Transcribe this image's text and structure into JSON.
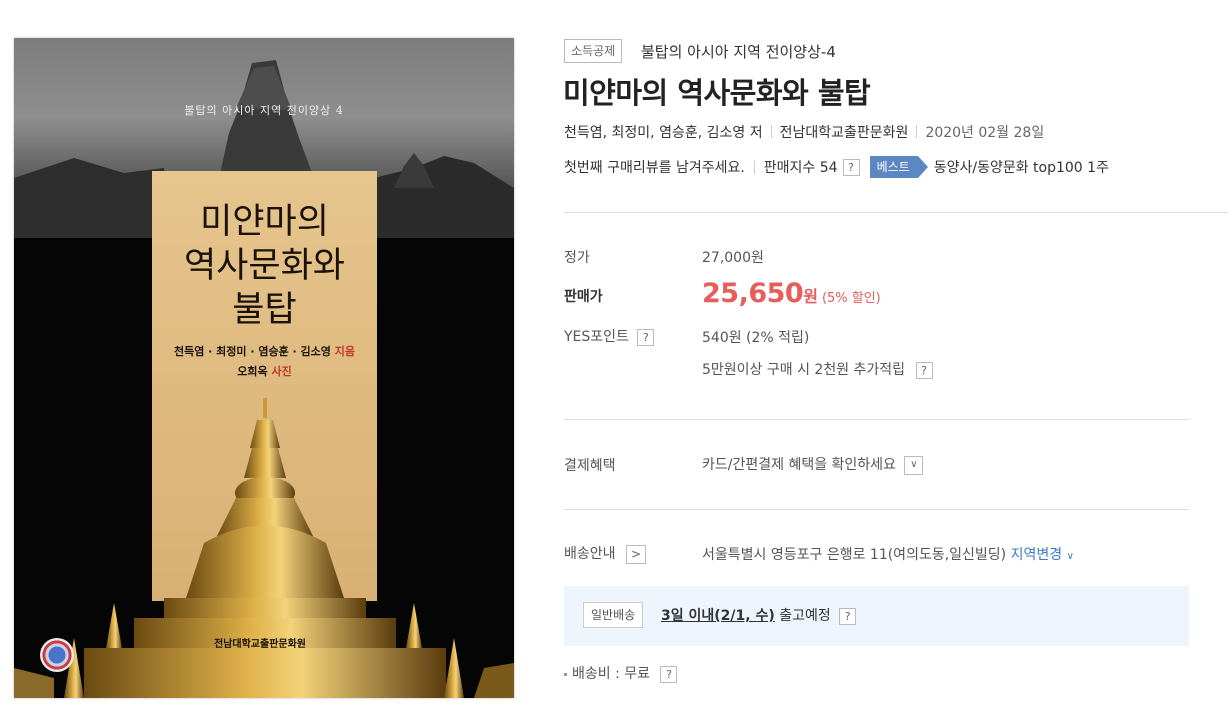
{
  "cover": {
    "series_label": "불탑의 아시아 지역 전이양상 4",
    "title_line1": "미얀마의",
    "title_line2": "역사문화와",
    "title_line3": "불탑",
    "authors": "천득염 · 최정미 · 염승훈 · 김소영",
    "authors_role": "지음",
    "photographer": "오희옥",
    "photographer_role": "사진",
    "publisher": "전남대학교출판문화원"
  },
  "header": {
    "badge": "소득공제",
    "series": "불탑의 아시아 지역 전이양상-4",
    "title": "미얀마의 역사문화와 불탑",
    "authors": "천득염, 최정미, 염승훈, 김소영 저",
    "publisher": "전남대학교출판문화원",
    "date": "2020년 02월 28일",
    "review_link": "첫번째 구매리뷰를 남겨주세요.",
    "sales_index": "판매지수 54",
    "help": "?",
    "best_badge": "베스트",
    "rank": "동양사/동양문화 top100 1주"
  },
  "price": {
    "list_label": "정가",
    "list_value": "27,000원",
    "sale_label": "판매가",
    "sale_value": "25,650",
    "sale_unit": "원",
    "discount": "(5% 할인)",
    "points_label": "YES포인트",
    "points_value": "540원 (2% 적립)",
    "bonus_text": "5만원이상 구매 시 2천원 추가적립"
  },
  "payment": {
    "label": "결제혜택",
    "text": "카드/간편결제 혜택을 확인하세요",
    "toggle": "∨"
  },
  "delivery": {
    "label": "배송안내",
    "arrow": ">",
    "address": "서울특별시 영등포구 은행로 11(여의도동,일신빌딩)",
    "change_region": "지역변경",
    "change_caret": "∨",
    "ship_type": "일반배송",
    "ship_date": "3일 이내(2/1, 수)",
    "ship_status": "출고예정",
    "fee": "배송비 : 무료"
  }
}
